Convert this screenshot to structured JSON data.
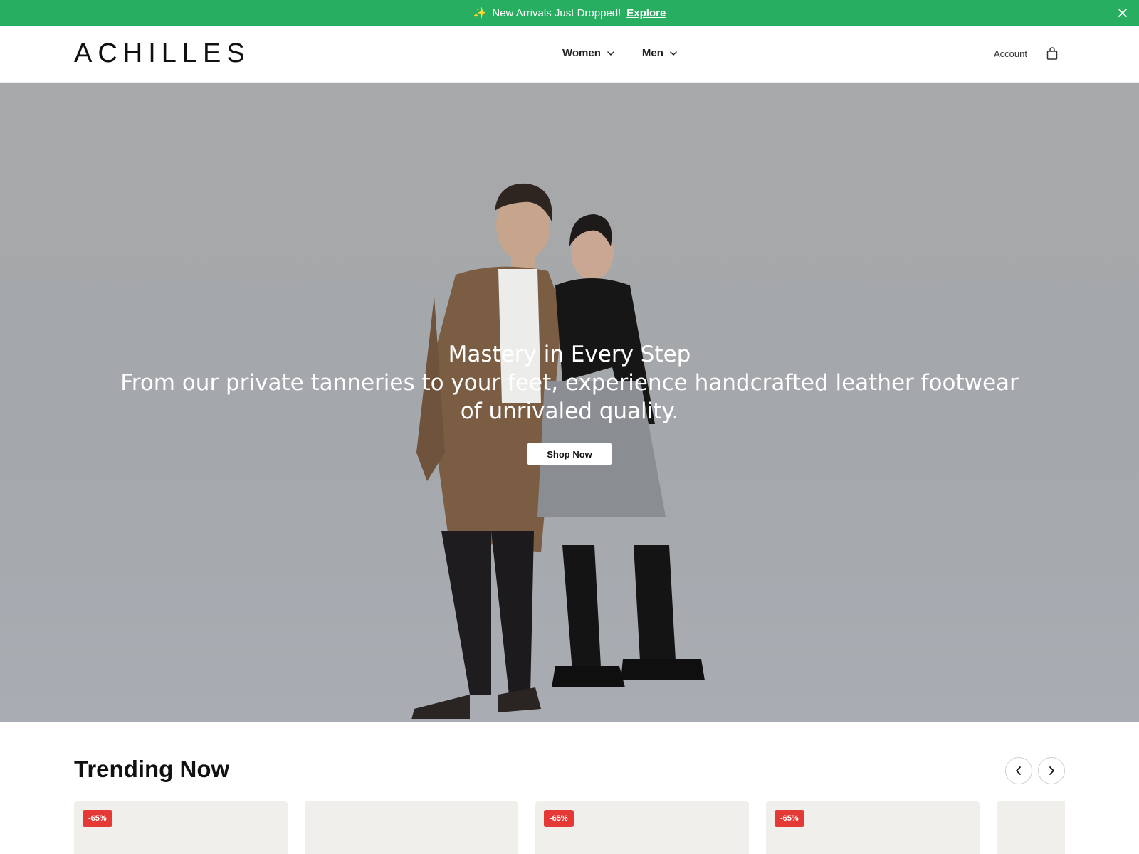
{
  "announcement": {
    "sparkle": "✨",
    "message": "New Arrivals Just Dropped!",
    "link_label": "Explore"
  },
  "header": {
    "logo": "ACHILLES",
    "nav": [
      {
        "label": "Women"
      },
      {
        "label": "Men"
      }
    ],
    "account_label": "Account"
  },
  "hero": {
    "title": "Mastery in Every Step",
    "subtitle": "From our private tanneries to your feet, experience handcrafted leather footwear of unrivaled quality.",
    "cta_label": "Shop Now"
  },
  "trending": {
    "title": "Trending Now",
    "cards": [
      {
        "badge": "-65%"
      },
      {
        "badge": ""
      },
      {
        "badge": "-65%"
      },
      {
        "badge": "-65%"
      },
      {
        "badge": ""
      }
    ]
  },
  "colors": {
    "announcement_bg": "#27ae60",
    "discount_badge": "#e53935",
    "card_bg": "#f0efec"
  }
}
